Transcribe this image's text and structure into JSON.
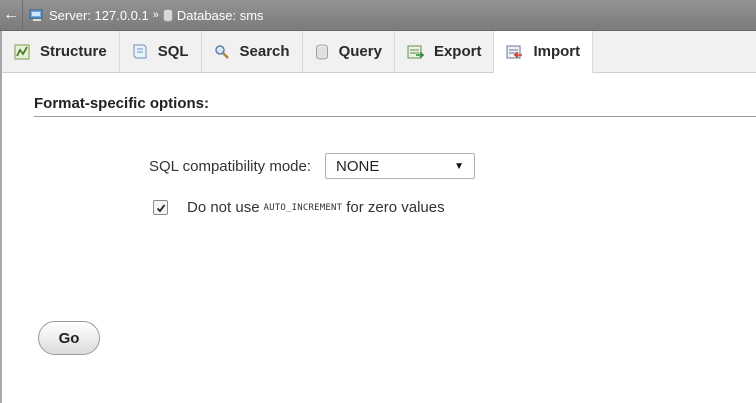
{
  "breadcrumb": {
    "back_icon": "back-arrow-icon",
    "server_label": "Server: 127.0.0.1",
    "separator": "»",
    "database_label": "Database: sms"
  },
  "tabs": [
    {
      "label": "Structure",
      "icon": "structure-icon",
      "active": false
    },
    {
      "label": "SQL",
      "icon": "sql-icon",
      "active": false
    },
    {
      "label": "Search",
      "icon": "search-icon",
      "active": false
    },
    {
      "label": "Query",
      "icon": "query-icon",
      "active": false
    },
    {
      "label": "Export",
      "icon": "export-icon",
      "active": false
    },
    {
      "label": "Import",
      "icon": "import-icon",
      "active": true
    }
  ],
  "section": {
    "title": "Format-specific options:"
  },
  "options": {
    "compat_label": "SQL compatibility mode:",
    "compat_value": "NONE",
    "checkbox_checked": true,
    "checkbox_text_before": "Do not use",
    "checkbox_code": "AUTO_INCREMENT",
    "checkbox_text_after": "for zero values"
  },
  "actions": {
    "go_label": "Go"
  },
  "colors": {
    "topbar": "#8a8a8a",
    "tab_bg": "#f1f1f1",
    "active_tab_bg": "#ffffff"
  }
}
